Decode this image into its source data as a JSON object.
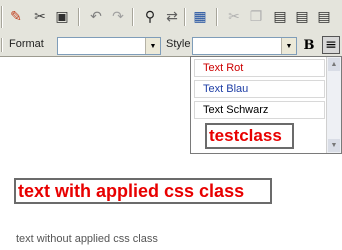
{
  "toolbar": {
    "icons": [
      {
        "name": "spell-check-icon",
        "glyph": "✎",
        "color": "#c04020"
      },
      {
        "name": "cut-icon",
        "glyph": "✂",
        "color": "#404040"
      },
      {
        "name": "save-icon",
        "glyph": "▣",
        "color": "#303030"
      },
      {
        "name": "undo-icon",
        "glyph": "↶",
        "color": "#808080"
      },
      {
        "name": "redo-icon",
        "glyph": "↷",
        "color": "#a0a0a0"
      },
      {
        "name": "find-icon",
        "glyph": "⚲",
        "color": "#202020"
      },
      {
        "name": "replace-icon",
        "glyph": "⇄",
        "color": "#606060"
      },
      {
        "name": "select-all-icon",
        "glyph": "▦",
        "color": "#2050a0"
      },
      {
        "name": "cut-scissors-icon",
        "glyph": "✂",
        "color": "#b0b0b0"
      },
      {
        "name": "copy-icon",
        "glyph": "❐",
        "color": "#b0b0b0"
      },
      {
        "name": "paste-icon",
        "glyph": "▤",
        "color": "#303030"
      },
      {
        "name": "paste-text-icon",
        "glyph": "▤",
        "color": "#303030"
      },
      {
        "name": "paste-word-icon",
        "glyph": "▤",
        "color": "#303030"
      }
    ]
  },
  "format": {
    "label": "Format",
    "value": ""
  },
  "style": {
    "label": "Style",
    "value": ""
  },
  "bold_label": "B",
  "align_glyph": "≡",
  "dropdown": {
    "items": [
      {
        "label": "Text Rot",
        "color": "#cc0000"
      },
      {
        "label": "Text Blau",
        "color": "#1f3fa6"
      },
      {
        "label": "Text Schwarz",
        "color": "#000000"
      }
    ],
    "highlight": {
      "label": "testclass",
      "color": "#e80000"
    }
  },
  "content": {
    "styled_text": "text with applied css class",
    "styled_color": "#e80000",
    "plain_text": "text without applied css class"
  }
}
